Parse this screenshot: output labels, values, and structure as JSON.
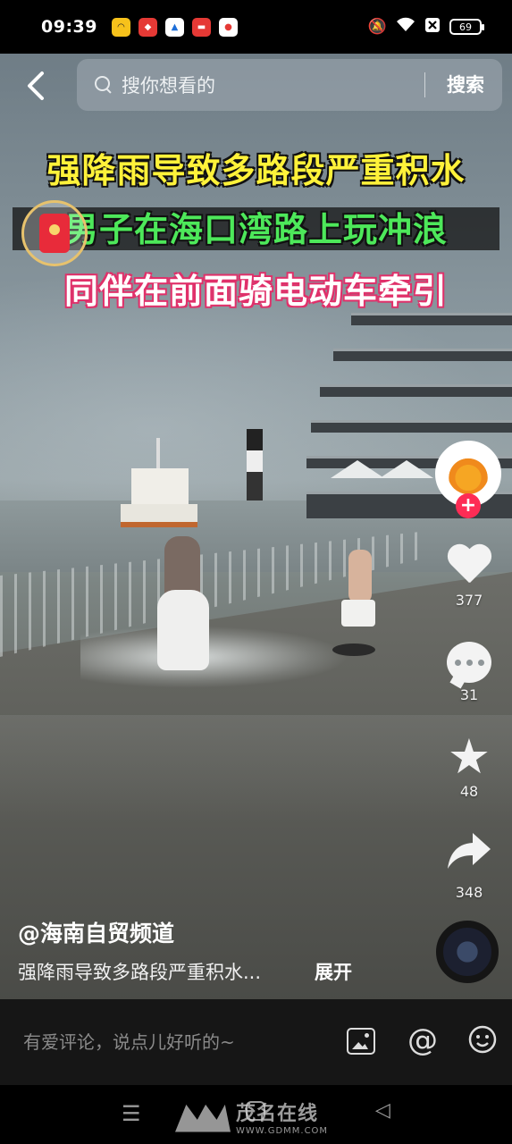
{
  "status_bar": {
    "time": "09:39",
    "battery": "69",
    "app_icons": [
      {
        "name": "app-icon-1",
        "color": "#f7c21b"
      },
      {
        "name": "app-icon-2",
        "color": "#e53935"
      },
      {
        "name": "app-icon-3",
        "color": "#1e6fd9"
      },
      {
        "name": "app-icon-4",
        "color": "#e53935"
      },
      {
        "name": "app-icon-5",
        "color": "#e53935"
      }
    ]
  },
  "search": {
    "placeholder": "搜你想看的",
    "button": "搜索"
  },
  "video": {
    "caption_lines": [
      "强降雨导致多路段严重积水",
      "男子在海口湾路上玩冲浪",
      "同伴在前面骑电动车牵引"
    ]
  },
  "actions": {
    "likes": "377",
    "comments": "31",
    "favorites": "48",
    "shares": "348",
    "follow_symbol": "+"
  },
  "post": {
    "author": "@海南自贸频道",
    "description": "强降雨导致多路段严重积水...",
    "expand_label": "展开"
  },
  "comment_bar": {
    "placeholder": "有爱评论，说点儿好听的~"
  },
  "watermark": {
    "name": "茂名在线",
    "url": "WWW.GDMM.COM"
  },
  "colors": {
    "accent": "#fe2c55",
    "caption_yellow": "#fff23a",
    "caption_green": "#4de85a"
  }
}
